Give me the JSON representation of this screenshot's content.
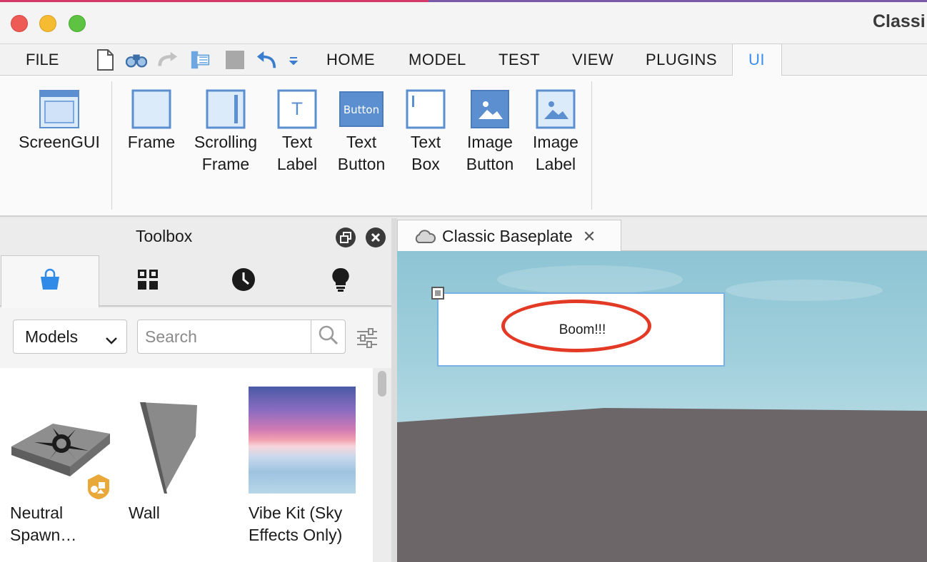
{
  "window": {
    "title": "Classi"
  },
  "menu": {
    "file": "FILE",
    "tabs": [
      "HOME",
      "MODEL",
      "TEST",
      "VIEW",
      "PLUGINS",
      "UI"
    ],
    "active_tab": "UI",
    "quick_access_icons": [
      "new-file-icon",
      "find-icon",
      "redo-icon",
      "sync-icon",
      "stop-icon",
      "undo-icon",
      "dropdown-icon"
    ]
  },
  "ribbon": {
    "buttons": [
      {
        "label": "ScreenGUI",
        "icon": "screengui-icon"
      },
      {
        "label": "Frame",
        "icon": "frame-icon"
      },
      {
        "label": "Scrolling\nFrame",
        "icon": "scrolling-frame-icon"
      },
      {
        "label": "Text\nLabel",
        "icon": "text-label-icon"
      },
      {
        "label": "Text\nButton",
        "icon": "text-button-icon",
        "icon_text": "Button"
      },
      {
        "label": "Text\nBox",
        "icon": "text-box-icon"
      },
      {
        "label": "Image\nButton",
        "icon": "image-button-icon"
      },
      {
        "label": "Image\nLabel",
        "icon": "image-label-icon"
      }
    ],
    "text_label_glyph": "T"
  },
  "toolbox": {
    "title": "Toolbox",
    "tabs": [
      "marketplace-bag-icon",
      "inventory-grid-icon",
      "recent-clock-icon",
      "creations-bulb-icon"
    ],
    "category": "Models",
    "search_placeholder": "Search",
    "assets": [
      {
        "name": "Neutral\nSpawn…"
      },
      {
        "name": "Wall"
      },
      {
        "name": "Vibe Kit (Sky\nEffects Only)"
      }
    ]
  },
  "viewport": {
    "tab_label": "Classic Baseplate",
    "gui_text": "Boom!!!"
  },
  "colors": {
    "accent": "#3b8fe8",
    "annotation": "#e33a26",
    "ground": "#6c6668",
    "sky": "#a1d0dc"
  }
}
